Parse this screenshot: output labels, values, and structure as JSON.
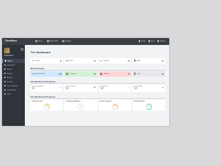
{
  "app": {
    "brand": "TimeBoss"
  },
  "topnav": [
    {
      "label": "Home"
    },
    {
      "label": "Edit Profile"
    },
    {
      "label": "Settings"
    }
  ],
  "topright": [
    {
      "label": "Alerts"
    },
    {
      "label": "Sync"
    },
    {
      "label": "Logout"
    }
  ],
  "sidebar": {
    "user": "Hi Ossama !",
    "items": [
      {
        "label": "Home",
        "active": true
      },
      {
        "label": "Dashboard"
      },
      {
        "label": "Clients"
      },
      {
        "label": "Projects"
      },
      {
        "label": "Reports"
      },
      {
        "label": "Invoices"
      },
      {
        "label": "Time Tracking"
      },
      {
        "label": "Notifications"
      },
      {
        "label": "Users"
      }
    ]
  },
  "main": {
    "title": "The Dashboard",
    "record_count_label": "Record Count",
    "circular_label_1": "Circular Record Progress",
    "circular_label_2": "Circular Record Progress",
    "count_row_1": [
      {
        "label": "Invoices",
        "value": "15",
        "icon": "∞"
      },
      {
        "label": "Folios",
        "value": "16",
        "icon": "✉"
      },
      {
        "label": "Products",
        "value": "16",
        "icon": "▭"
      },
      {
        "label": "Alerts",
        "value": "35",
        "icon": "⧉"
      }
    ],
    "count_row_2": [
      {
        "label": "Active Products",
        "value": "273",
        "icon": "∞",
        "color": "blue"
      },
      {
        "label": "Categories",
        "value": "55",
        "icon": "▦",
        "color": "green"
      },
      {
        "label": "Materials",
        "value": "75",
        "icon": "▣",
        "color": "red"
      },
      {
        "label": "Logs",
        "value": "24",
        "icon": "⧉",
        "color": "grey"
      }
    ],
    "circular_row_1": [
      {
        "label": "Customers",
        "sub": "",
        "icon": "○"
      },
      {
        "label": "Products",
        "sub": "",
        "icon": "○"
      },
      {
        "label": "Users",
        "sub": "",
        "icon": "○"
      },
      {
        "label": "Orders",
        "sub": "",
        "icon": "○"
      }
    ],
    "circular_row_2": [
      {
        "label": "Completed Job",
        "value": "25",
        "color": "#f5b041"
      },
      {
        "label": "Completed Milestone",
        "value": "0",
        "color": "#cfd3da"
      },
      {
        "label": "Project Progress",
        "value": "25",
        "color": "#f5b041"
      },
      {
        "label": "Finished Tasks",
        "value": "85",
        "color": "#58d68d"
      }
    ]
  }
}
